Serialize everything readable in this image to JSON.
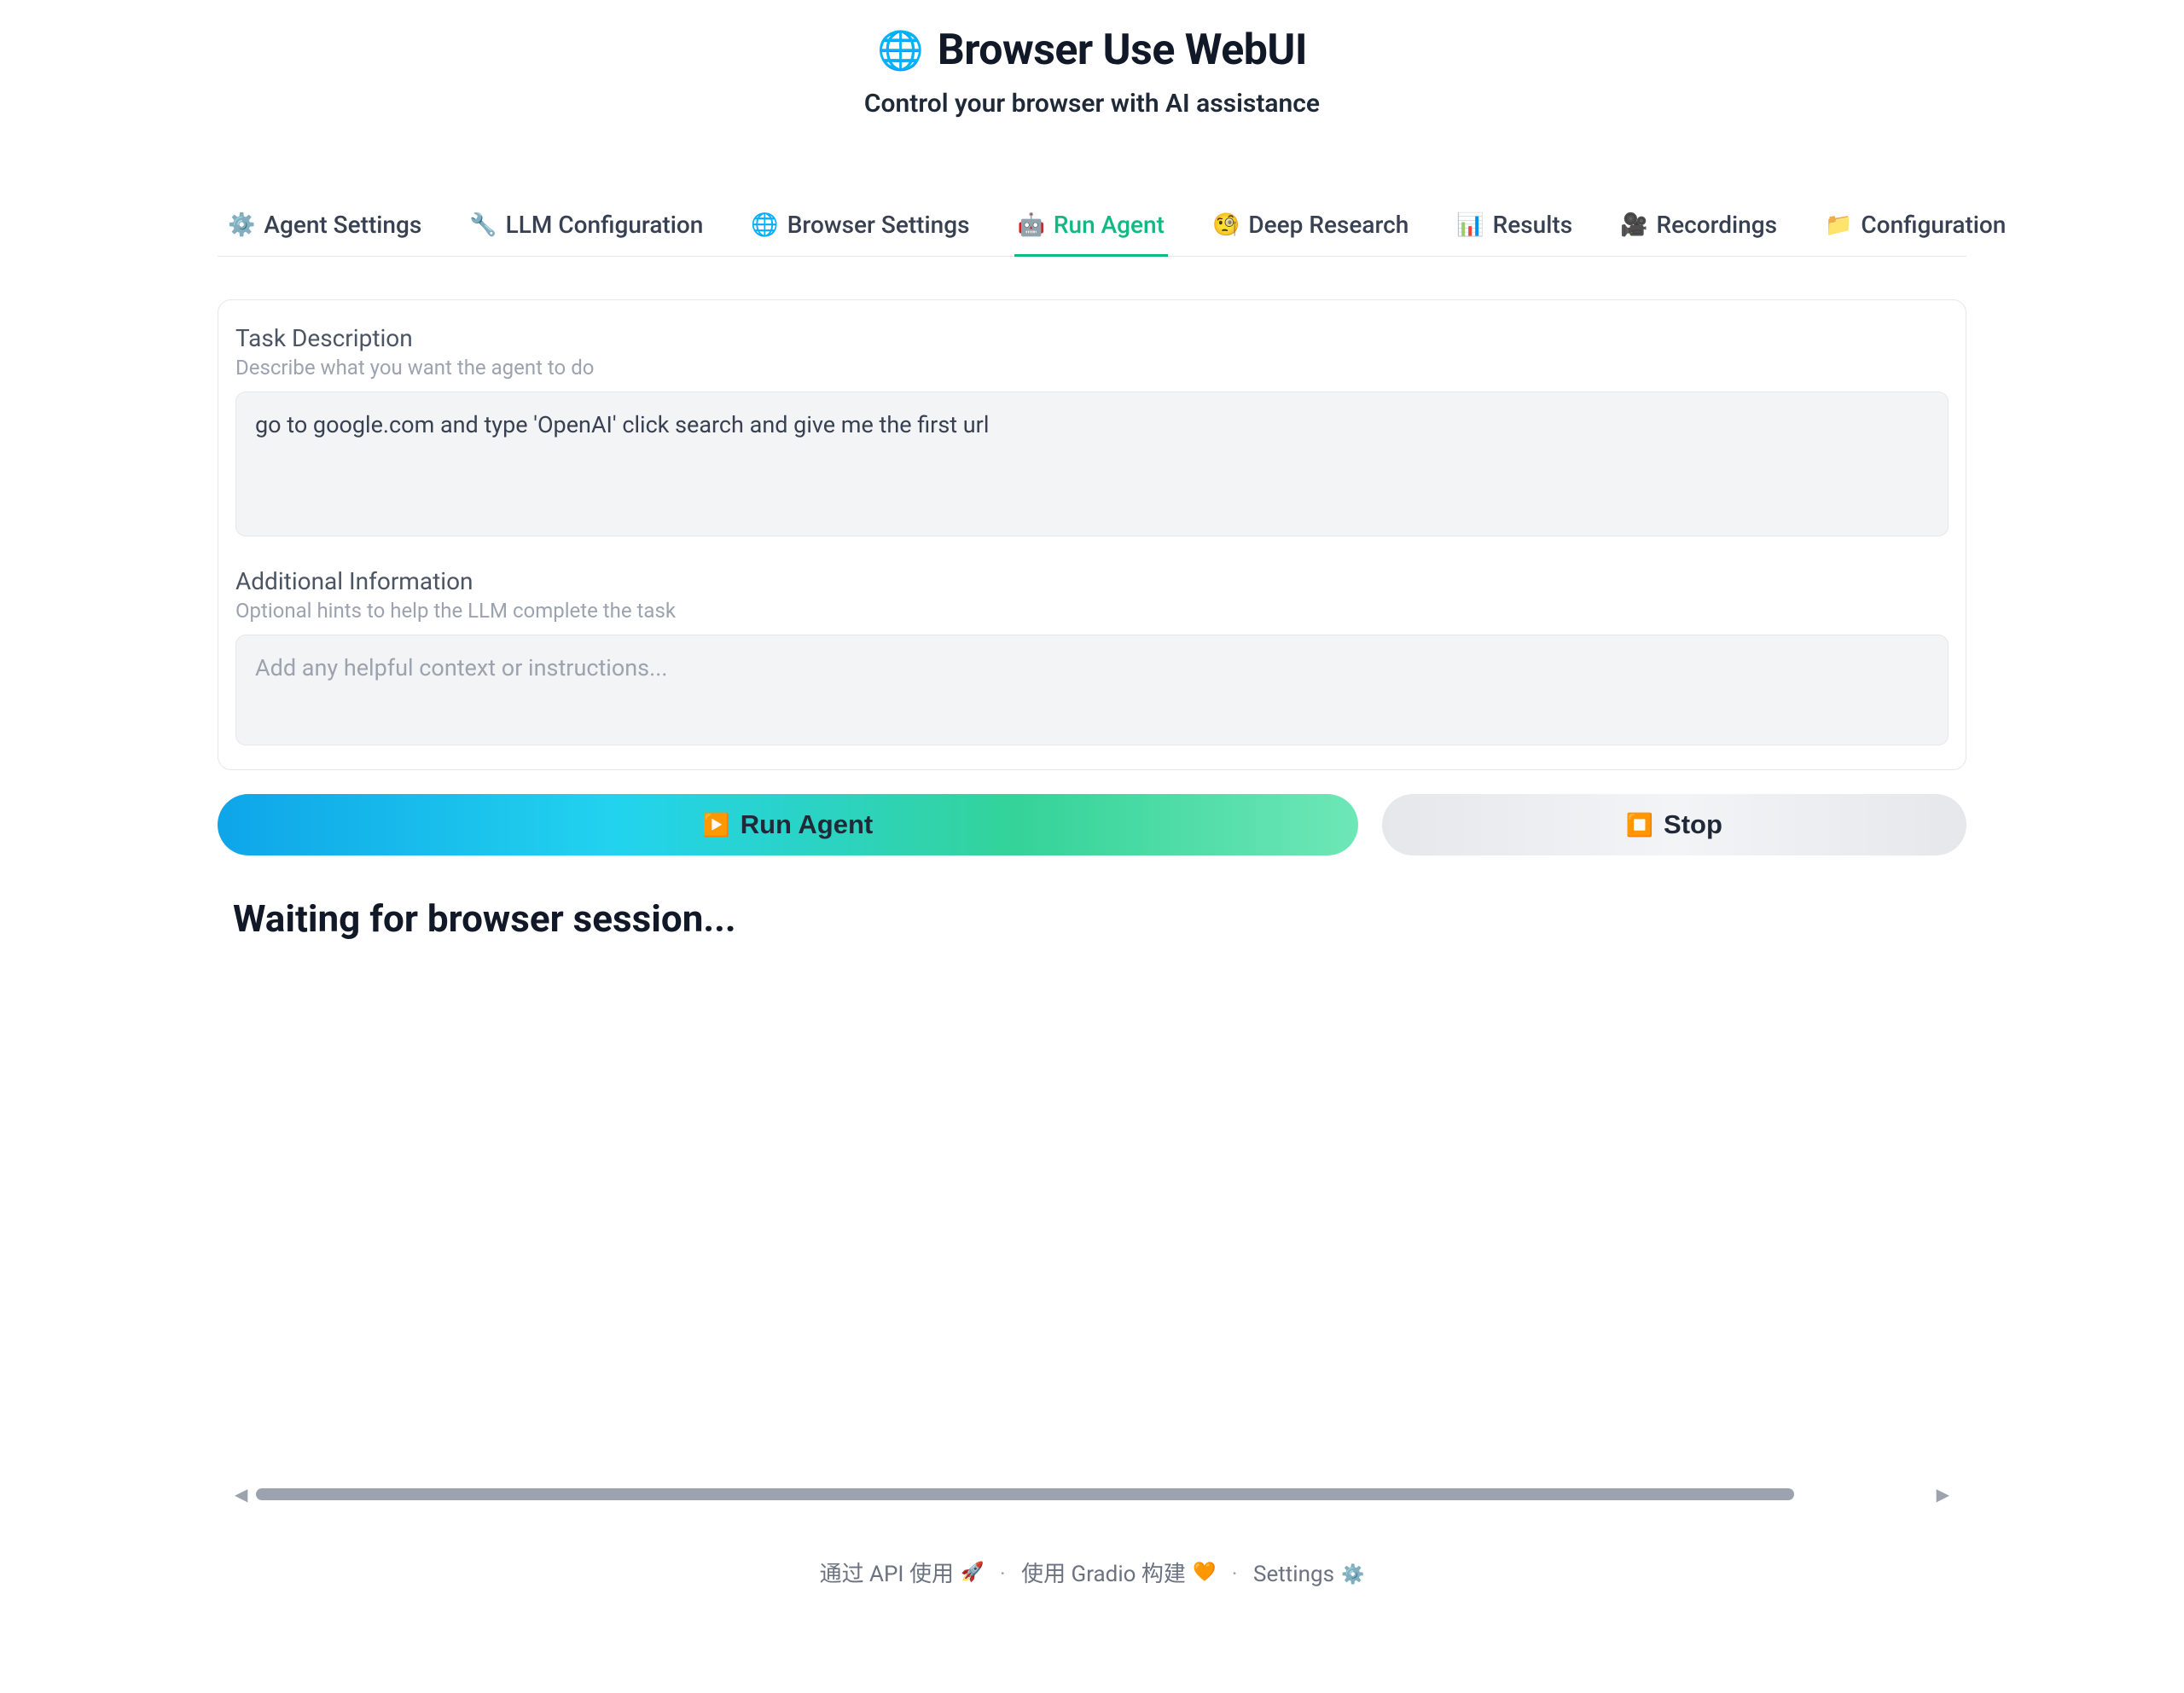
{
  "header": {
    "title": "Browser Use WebUI",
    "subtitle": "Control your browser with AI assistance"
  },
  "tabs": [
    {
      "icon": "⚙️",
      "label": "Agent Settings",
      "active": false
    },
    {
      "icon": "🔧",
      "label": "LLM Configuration",
      "active": false
    },
    {
      "icon": "🌐",
      "label": "Browser Settings",
      "active": false
    },
    {
      "icon": "🤖",
      "label": "Run Agent",
      "active": true
    },
    {
      "icon": "🧐",
      "label": "Deep Research",
      "active": false
    },
    {
      "icon": "📊",
      "label": "Results",
      "active": false
    },
    {
      "icon": "🎥",
      "label": "Recordings",
      "active": false
    },
    {
      "icon": "📁",
      "label": "Configuration",
      "active": false
    }
  ],
  "task": {
    "label": "Task Description",
    "hint": "Describe what you want the agent to do",
    "value": "go to google.com and type 'OpenAI' click search and give me the first url"
  },
  "additional": {
    "label": "Additional Information",
    "hint": "Optional hints to help the LLM complete the task",
    "placeholder": "Add any helpful context or instructions..."
  },
  "buttons": {
    "run": {
      "icon": "▶️",
      "label": "Run Agent"
    },
    "stop": {
      "icon": "⏹️",
      "label": "Stop"
    }
  },
  "status": "Waiting for browser session...",
  "footer": {
    "api": "通过 API 使用",
    "api_icon": "🚀",
    "gradio": "使用 Gradio 构建",
    "gradio_icon": "🧡",
    "settings": "Settings",
    "settings_icon": "⚙️"
  }
}
